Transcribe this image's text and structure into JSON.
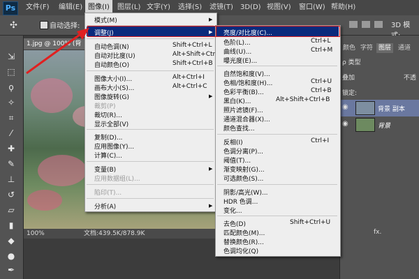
{
  "app": {
    "logo": "Ps"
  },
  "menubar": [
    "文件(F)",
    "编辑(E)",
    "图像(I)",
    "图层(L)",
    "文字(Y)",
    "选择(S)",
    "滤镜(T)",
    "3D(D)",
    "视图(V)",
    "窗口(W)",
    "帮助(H)"
  ],
  "options": {
    "auto_select": "自动选择:",
    "mode_3d": "3D 模式:"
  },
  "document": {
    "tab": "1.jpg @ 100% (背",
    "zoom": "100%",
    "info": "文档:439.5K/878.9K"
  },
  "panels": {
    "tabs": [
      "颜色",
      "字符",
      "图层",
      "通道"
    ],
    "kind": "ρ 类型",
    "blend": "叠加",
    "opacity_label": "不透",
    "lock": "锁定:",
    "layers": [
      {
        "name": "背景 副本"
      },
      {
        "name": "背景"
      }
    ],
    "fx": "fx."
  },
  "image_menu": {
    "items": [
      {
        "label": "模式(M)",
        "shortcut": "",
        "submenu": true
      },
      {
        "label": "调整(J)",
        "shortcut": "",
        "submenu": true
      },
      {
        "label": "自动色调(N)",
        "shortcut": "Shift+Ctrl+L"
      },
      {
        "label": "自动对比度(U)",
        "shortcut": "Alt+Shift+Ctrl+L"
      },
      {
        "label": "自动颜色(O)",
        "shortcut": "Shift+Ctrl+B"
      },
      {
        "label": "图像大小(I)...",
        "shortcut": "Alt+Ctrl+I"
      },
      {
        "label": "画布大小(S)...",
        "shortcut": "Alt+Ctrl+C"
      },
      {
        "label": "图像旋转(G)",
        "shortcut": "",
        "submenu": true
      },
      {
        "label": "裁剪(P)",
        "shortcut": "",
        "disabled": true
      },
      {
        "label": "裁切(R)...",
        "shortcut": ""
      },
      {
        "label": "显示全部(V)",
        "shortcut": ""
      },
      {
        "label": "复制(D)...",
        "shortcut": ""
      },
      {
        "label": "应用图像(Y)...",
        "shortcut": ""
      },
      {
        "label": "计算(C)...",
        "shortcut": ""
      },
      {
        "label": "变量(B)",
        "shortcut": "",
        "submenu": true
      },
      {
        "label": "应用数据组(L)...",
        "shortcut": "",
        "disabled": true
      },
      {
        "label": "陷印(T)...",
        "shortcut": "",
        "disabled": true
      },
      {
        "label": "分析(A)",
        "shortcut": "",
        "submenu": true
      }
    ]
  },
  "adjust_menu": {
    "items": [
      {
        "label": "亮度/对比度(C)...",
        "shortcut": ""
      },
      {
        "label": "色阶(L)...",
        "shortcut": "Ctrl+L"
      },
      {
        "label": "曲线(U)...",
        "shortcut": "Ctrl+M"
      },
      {
        "label": "曝光度(E)...",
        "shortcut": ""
      },
      {
        "label": "自然饱和度(V)...",
        "shortcut": ""
      },
      {
        "label": "色相/饱和度(H)...",
        "shortcut": "Ctrl+U"
      },
      {
        "label": "色彩平衡(B)...",
        "shortcut": "Ctrl+B"
      },
      {
        "label": "黑白(K)...",
        "shortcut": "Alt+Shift+Ctrl+B"
      },
      {
        "label": "照片滤镜(F)...",
        "shortcut": ""
      },
      {
        "label": "通道混合器(X)...",
        "shortcut": ""
      },
      {
        "label": "颜色查找...",
        "shortcut": ""
      },
      {
        "label": "反相(I)",
        "shortcut": "Ctrl+I"
      },
      {
        "label": "色调分离(P)...",
        "shortcut": ""
      },
      {
        "label": "阈值(T)...",
        "shortcut": ""
      },
      {
        "label": "渐变映射(G)...",
        "shortcut": ""
      },
      {
        "label": "可选颜色(S)...",
        "shortcut": ""
      },
      {
        "label": "阴影/高光(W)...",
        "shortcut": ""
      },
      {
        "label": "HDR 色调...",
        "shortcut": ""
      },
      {
        "label": "变化...",
        "shortcut": ""
      },
      {
        "label": "去色(D)",
        "shortcut": "Shift+Ctrl+U"
      },
      {
        "label": "匹配颜色(M)...",
        "shortcut": ""
      },
      {
        "label": "替换颜色(R)...",
        "shortcut": ""
      },
      {
        "label": "色调均化(Q)",
        "shortcut": ""
      }
    ]
  },
  "colors": {
    "highlight": "#0a2a7c",
    "annotation": "#e02020"
  }
}
